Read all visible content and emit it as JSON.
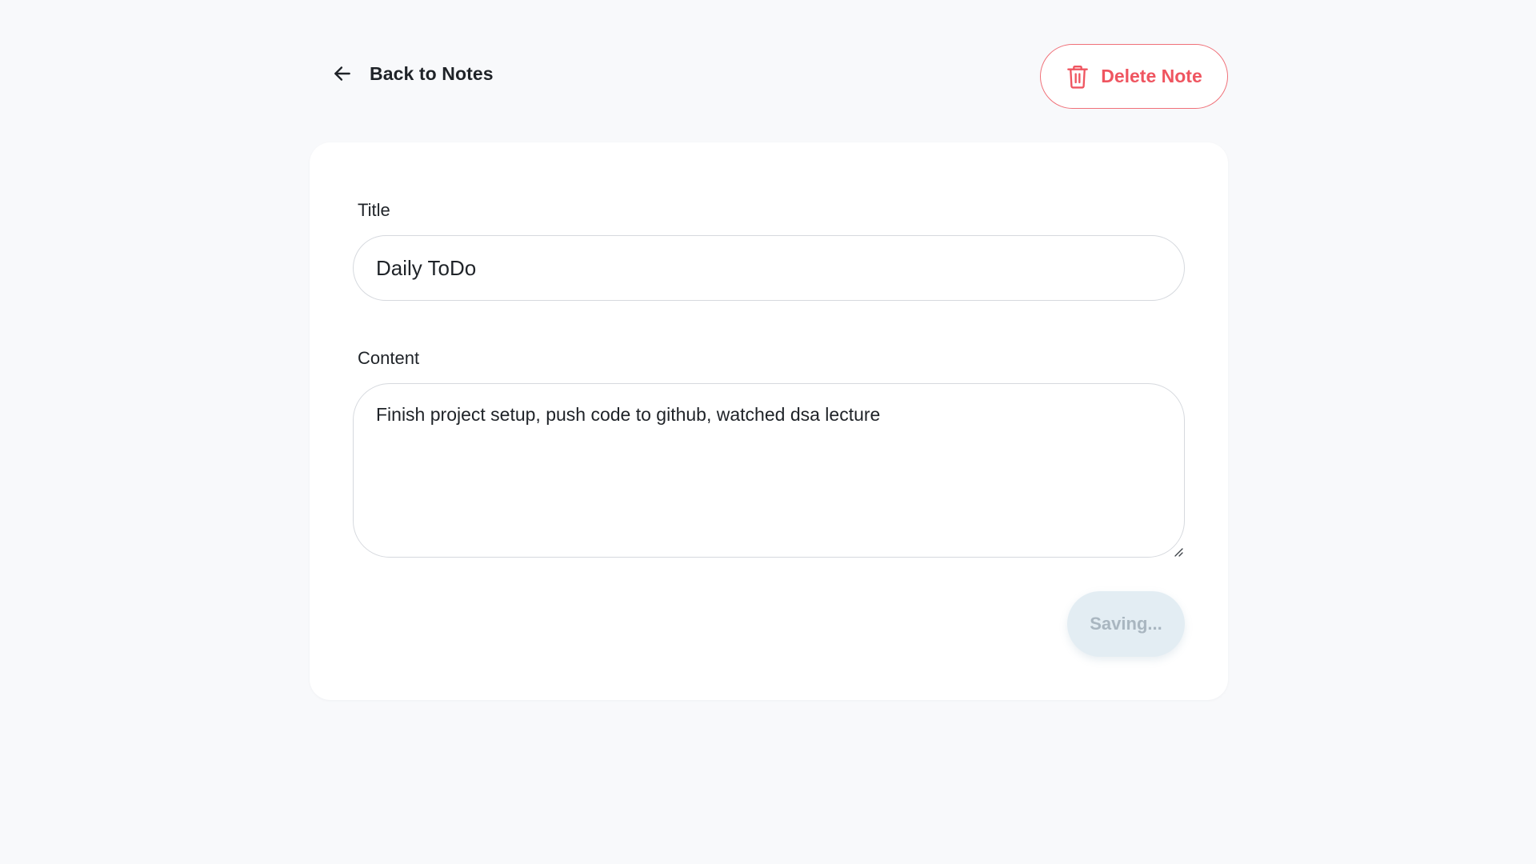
{
  "header": {
    "back_label": "Back to Notes",
    "delete_label": "Delete Note"
  },
  "form": {
    "title_label": "Title",
    "title_value": "Daily ToDo",
    "content_label": "Content",
    "content_value": "Finish project setup, push code to github, watched dsa lecture",
    "save_label": "Saving..."
  },
  "icons": {
    "back": "arrow-left-icon",
    "delete": "trash-icon",
    "resize": "resize-grip-icon"
  },
  "colors": {
    "background": "#f8f9fb",
    "card": "#ffffff",
    "danger": "#ef5560",
    "danger_border": "#f07179",
    "save_bg": "#e3edf3",
    "save_text": "#a9b6c0",
    "input_border": "#d6d9de"
  }
}
